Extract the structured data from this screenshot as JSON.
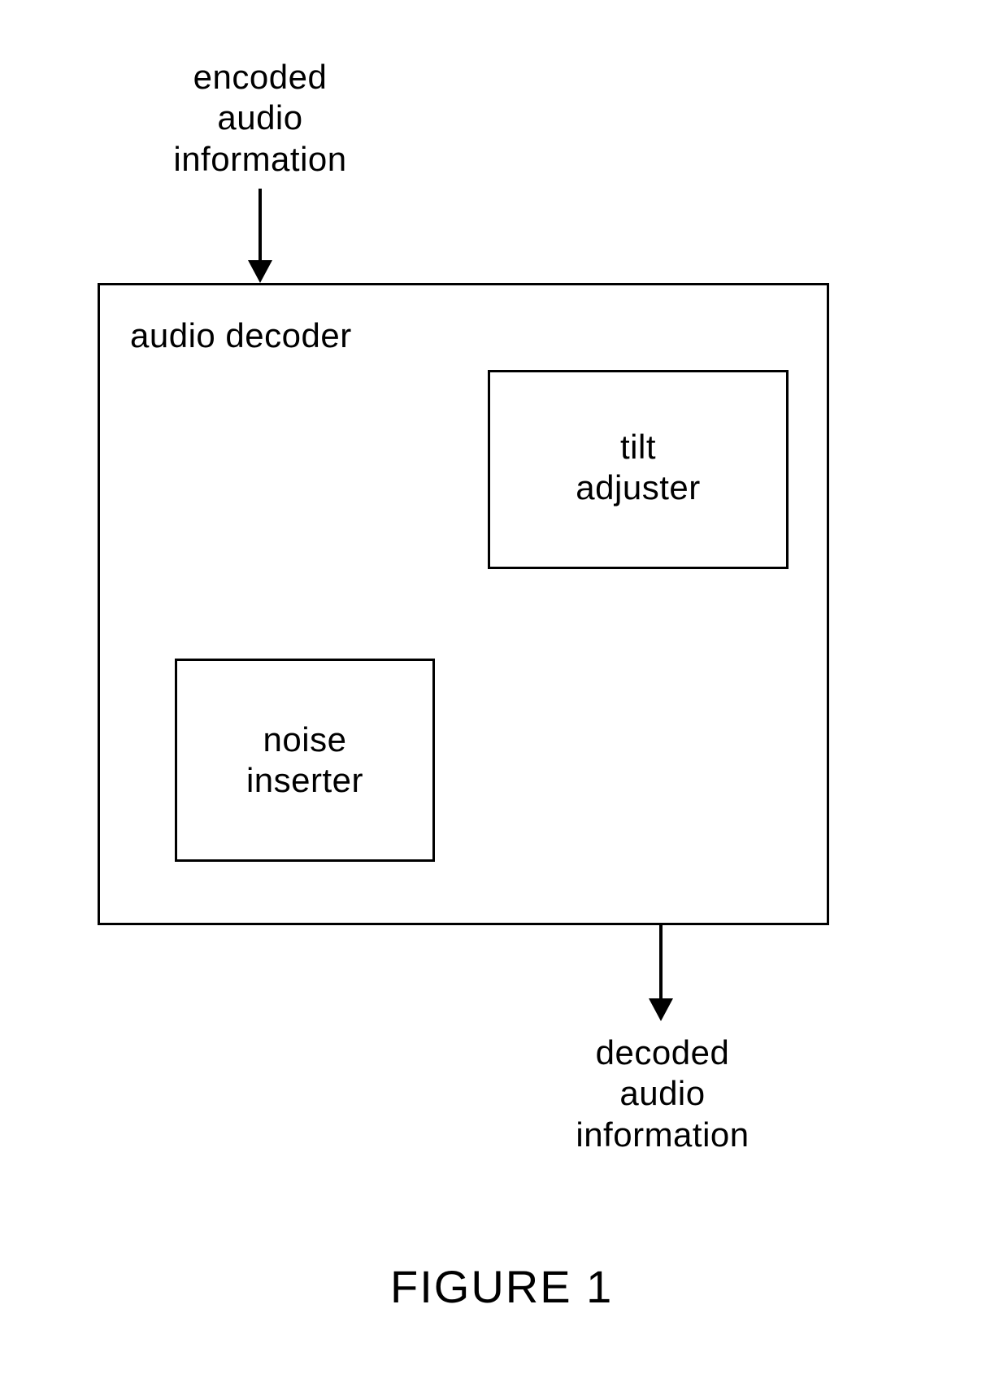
{
  "input_label": "encoded\naudio\ninformation",
  "decoder_label": "audio decoder",
  "tilt_label": "tilt\nadjuster",
  "noise_label": "noise\ninserter",
  "output_label": "decoded\naudio\ninformation",
  "caption": "FIGURE 1"
}
